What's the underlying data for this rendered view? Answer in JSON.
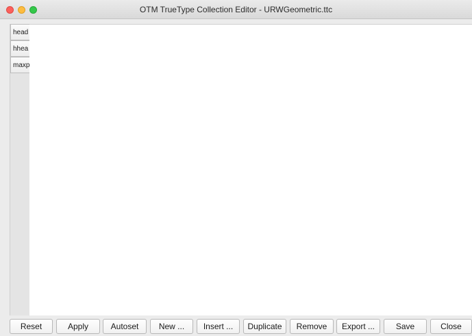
{
  "window": {
    "title": "OTM TrueType Collection Editor - URWGeometric.ttc"
  },
  "side_tabs": [
    {
      "label": "head"
    },
    {
      "label": "hhea"
    },
    {
      "label": "maxp"
    }
  ],
  "buttons": [
    {
      "label": "Reset"
    },
    {
      "label": "Apply"
    },
    {
      "label": "Autoset"
    },
    {
      "label": "New ..."
    },
    {
      "label": "Insert ..."
    },
    {
      "label": "Duplicate"
    },
    {
      "label": "Remove"
    },
    {
      "label": "Export ..."
    },
    {
      "label": "Save"
    },
    {
      "label": "Close"
    }
  ],
  "colors": {
    "close": "#fc605c",
    "minimize": "#fdbc40",
    "zoom": "#34c84a"
  }
}
